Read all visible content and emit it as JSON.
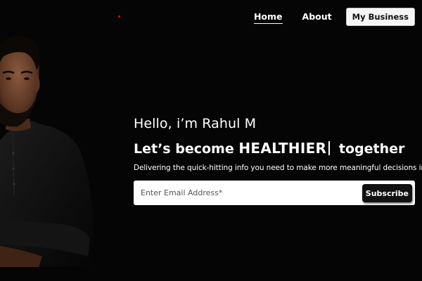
{
  "nav": {
    "home_label": "Home",
    "about_label": "About",
    "business_label": "My Business"
  },
  "hero": {
    "greeting": "Hello, i’m Rahul M",
    "tagline_prefix": "Let’s become",
    "tagline_emphasis": "HEALTHIER",
    "tagline_suffix": "together",
    "subtext": "Delivering the quick-hitting info you need to make more meaningful decisions in life."
  },
  "subscribe": {
    "placeholder": "Enter Email Address*",
    "button_label": "Subscribe"
  },
  "colors": {
    "background": "#050505",
    "accent": "#dd1111"
  }
}
